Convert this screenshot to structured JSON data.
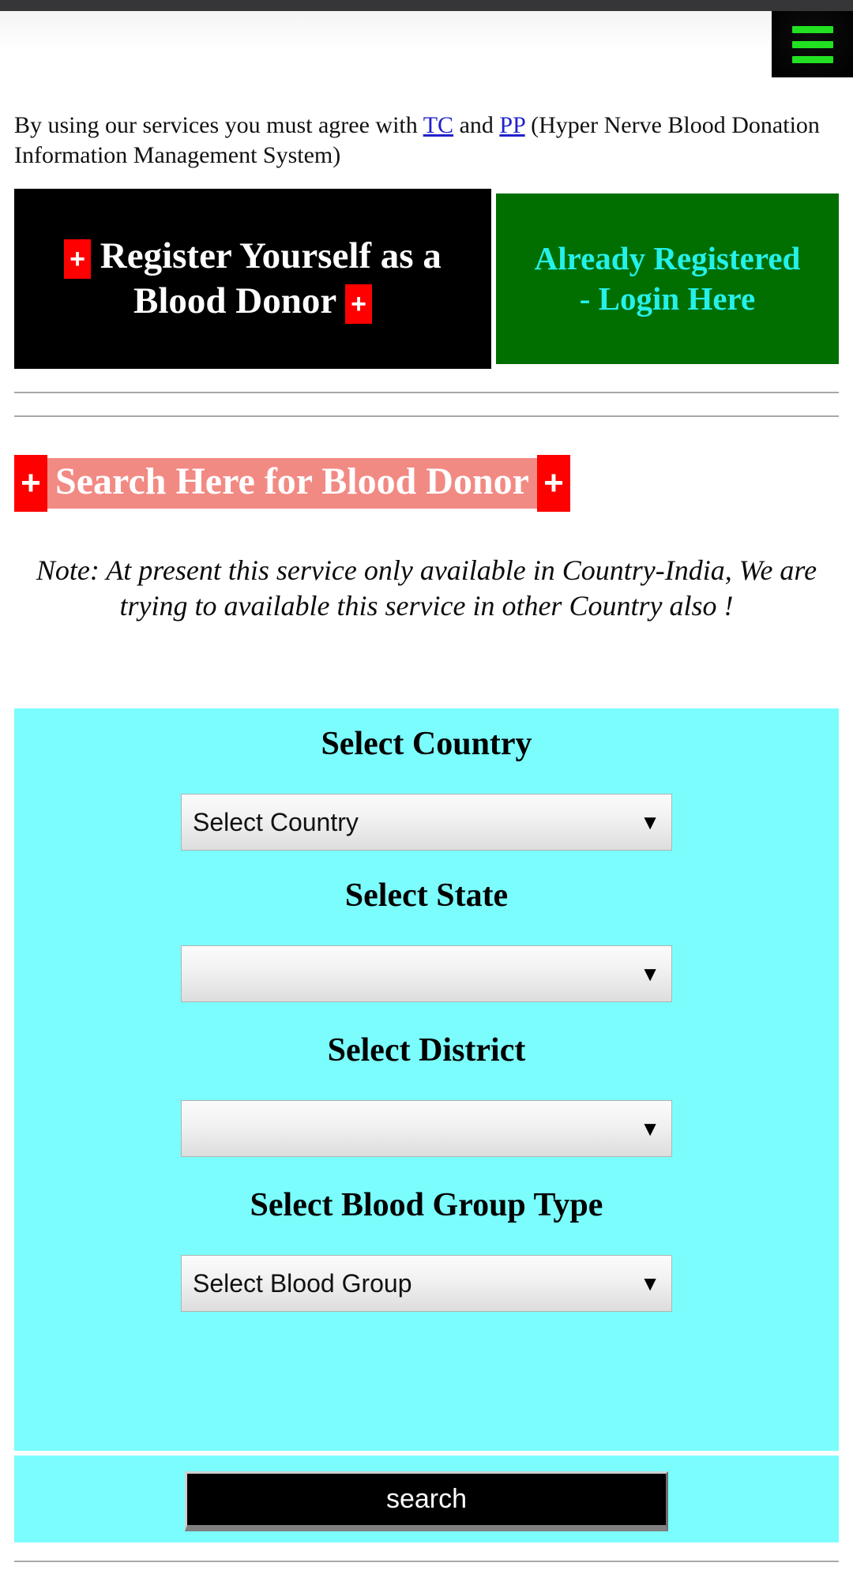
{
  "header": {
    "menu_icon": "hamburger-menu-icon",
    "menu_bar_color": "#22e022",
    "menu_bg_color": "#000000",
    "topbar_color": "#363639"
  },
  "agreement": {
    "prefix": "By using our services you must agree with ",
    "link_tc": "TC",
    "middle": " and ",
    "link_pp": "PP",
    "suffix": " (Hyper Nerve Blood Donation Information Management System)",
    "link_color": "#2222cc"
  },
  "banner": {
    "register_plus_left": "+",
    "register_line1": "Register Yourself as a",
    "register_line2": "Blood Donor",
    "register_plus_right": "+",
    "register_bg": "#000000",
    "register_text_color": "#ffffff",
    "login_line1": "Already Registered",
    "login_line2": "- Login Here",
    "login_bg": "#006f00",
    "login_text_color": "#25f0ea"
  },
  "search_section": {
    "plus_left": "+",
    "heading": "Search Here for Blood Donor",
    "plus_right": "+",
    "heading_bg": "#f28a84",
    "heading_color": "#ffffff",
    "plus_box_color": "#ff0000",
    "note": "Note: At present this service only available in Country-India, We are trying to available this service in other Country also !"
  },
  "form": {
    "panel_bg": "#7bfdfd",
    "fields": [
      {
        "label": "Select Country",
        "value": "Select Country",
        "arrow": "▼"
      },
      {
        "label": "Select State",
        "value": "",
        "arrow": "▼"
      },
      {
        "label": "Select District",
        "value": "",
        "arrow": "▼"
      },
      {
        "label": "Select Blood Group Type",
        "value": "Select Blood Group",
        "arrow": "▼"
      }
    ],
    "search_button_label": "search",
    "search_button_bg": "#000000",
    "search_button_color": "#ffffff"
  }
}
